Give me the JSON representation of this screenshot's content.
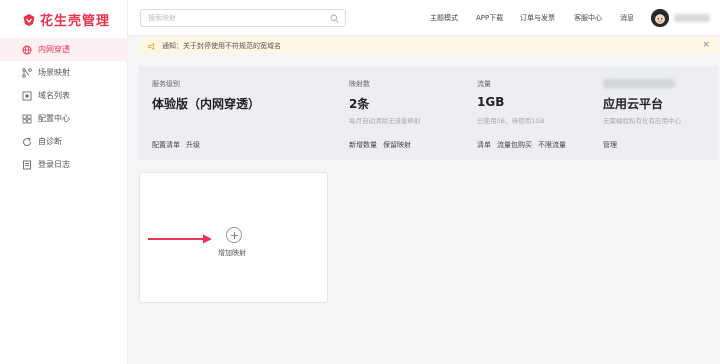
{
  "brand": {
    "name": "花生壳管理",
    "color": "#e8344e"
  },
  "sidebar": {
    "items": [
      {
        "label": "内网穿透",
        "icon": "globe-icon",
        "active": true
      },
      {
        "label": "场景映射",
        "icon": "branch-icon",
        "active": false
      },
      {
        "label": "域名列表",
        "icon": "domain-icon",
        "active": false
      },
      {
        "label": "配置中心",
        "icon": "grid-icon",
        "active": false
      },
      {
        "label": "自诊断",
        "icon": "refresh-icon",
        "active": false
      },
      {
        "label": "登录日志",
        "icon": "log-icon",
        "active": false
      }
    ]
  },
  "header": {
    "search_placeholder": "搜索映射",
    "nav": [
      "主题模式",
      "APP下载",
      "订单与发票",
      "客服中心",
      "消息"
    ]
  },
  "notice": {
    "text": "通知：关于封停使用不符规范的宽域名",
    "icon": "megaphone-icon"
  },
  "stats": {
    "service": {
      "label": "服务级别",
      "value": "体验版（内网穿透）",
      "links": [
        "配置清单",
        "升级"
      ]
    },
    "mappings": {
      "label": "映射数",
      "value": "2条",
      "sub": "每月自动清除无流量映射",
      "links": [
        "新增数量",
        "保留映射"
      ]
    },
    "traffic": {
      "label": "流量",
      "value": "1GB",
      "sub": "已使用0B，待使用1GB",
      "links": [
        "清单",
        "流量包购买",
        "不限流量"
      ]
    },
    "cloud": {
      "value": "应用云平台",
      "sub": "无需编程私有化有应用中心",
      "links": [
        "管理"
      ]
    }
  },
  "add_card": {
    "label": "增加映射"
  },
  "colors": {
    "accent": "#e8344e",
    "arrow": "#e8344e",
    "notice_bg": "#fdf6e3"
  }
}
